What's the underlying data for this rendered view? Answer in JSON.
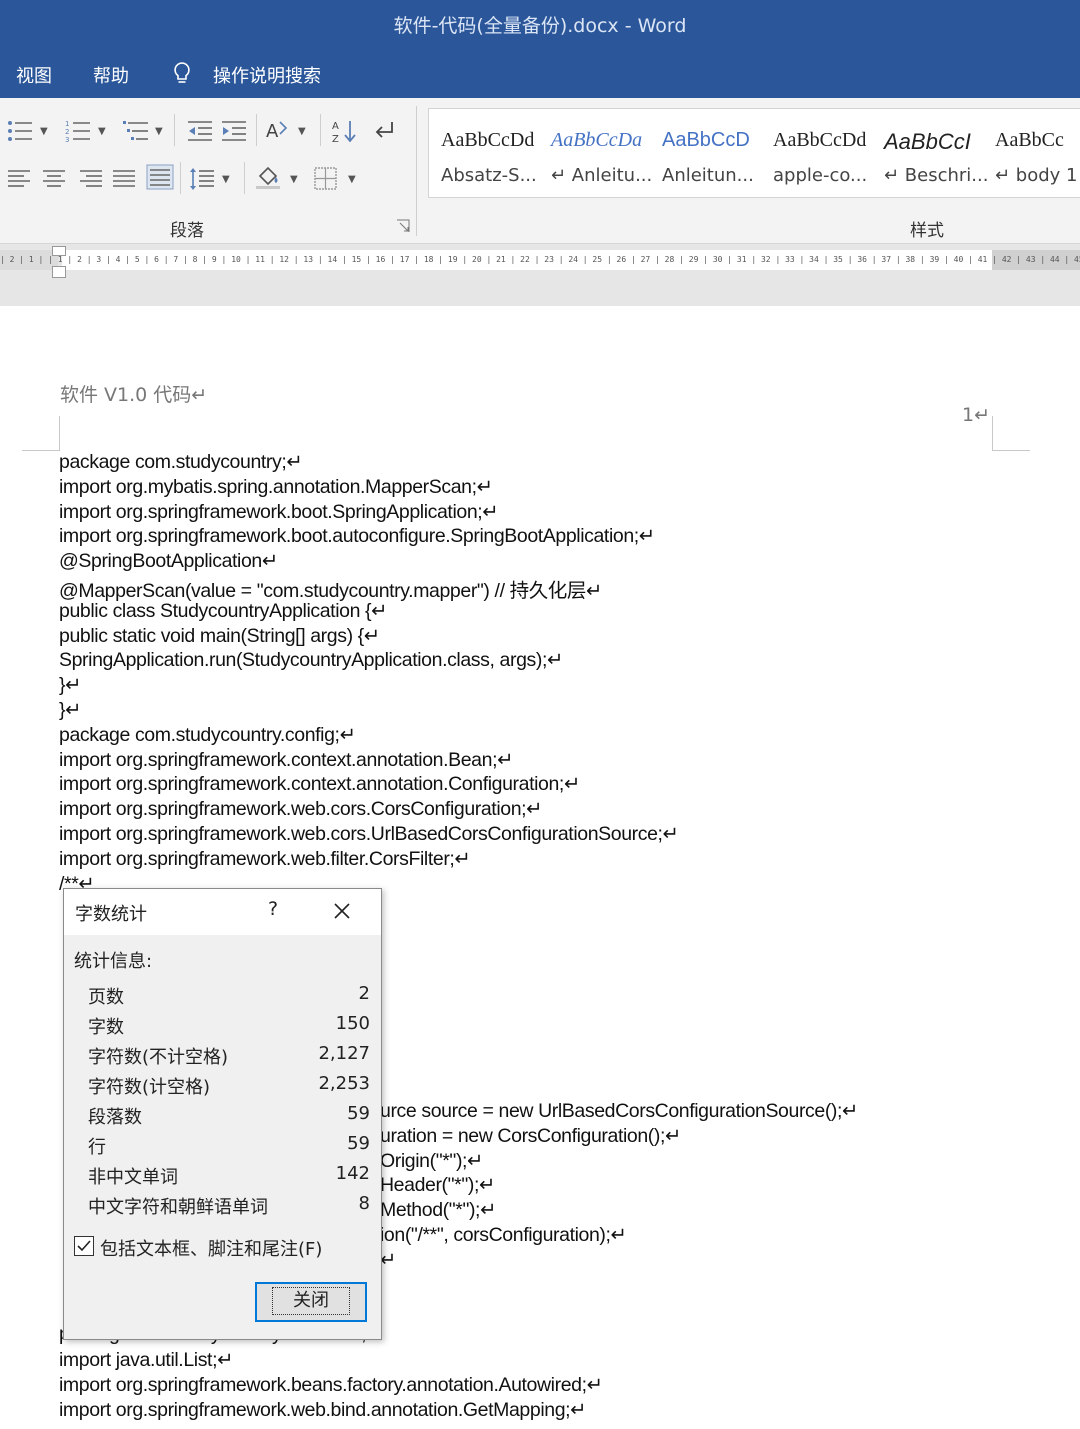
{
  "window": {
    "title": "软件-代码(全量备份).docx  -  Word"
  },
  "menu": {
    "items": [
      "视图",
      "帮助"
    ],
    "tell_me": "操作说明搜索"
  },
  "ribbon": {
    "paragraph_label": "段落",
    "styles_label": "样式",
    "styles": [
      {
        "sample": "AaBbCcDd",
        "name": "Absatz-S..."
      },
      {
        "sample": "AaBbCcDa",
        "name": "↵ Anleitu..."
      },
      {
        "sample": "AaBbCcD",
        "name": "Anleitun..."
      },
      {
        "sample": "AaBbCcDd",
        "name": "apple-co..."
      },
      {
        "sample": "AaBbCcI",
        "name": "↵ Beschri..."
      },
      {
        "sample": "AaBbCc",
        "name": "↵ body 1"
      }
    ]
  },
  "ruler": {
    "text": "| 2 | 1 |  | 1 | 2 | 3 | 4 | 5 | 6 | 7 | 8 | 9 | 10 | 11 | 12 | 13 | 14 | 15 | 16 | 17 | 18 | 19 | 20 | 21 | 22 | 23 | 24 | 25 | 26 | 27 | 28 | 29 | 30 | 31 | 32 | 33 | 34 | 35 | 36 | 37 | 38 | 39 | 40 | 41 | 42 | 43 | 44 | 45 | 46 | 47 | 48 | 49 |"
  },
  "document": {
    "header_left": "软件 V1.0  代码↵",
    "page_number": "1↵",
    "lines": [
      "package com.studycountry;↵",
      "import org.mybatis.spring.annotation.MapperScan;↵",
      "import org.springframework.boot.SpringApplication;↵",
      "import org.springframework.boot.autoconfigure.SpringBootApplication;↵",
      "@SpringBootApplication↵",
      "@MapperScan(value = \"com.studycountry.mapper\") // 持久化层↵",
      "public class StudycountryApplication {↵",
      "        public static void main(String[] args) {↵",
      "                SpringApplication.run(StudycountryApplication.class, args);↵",
      "        }↵",
      "}↵",
      "package com.studycountry.config;↵",
      "import org.springframework.context.annotation.Bean;↵",
      "import org.springframework.context.annotation.Configuration;↵",
      "import org.springframework.web.cors.CorsConfiguration;↵",
      "import org.springframework.web.cors.UrlBasedCorsConfigurationSource;↵",
      "import org.springframework.web.filter.CorsFilter;↵",
      "/**↵"
    ],
    "partial_lines": [
      "urce source = new UrlBasedCorsConfigurationSource();↵",
      "uration = new CorsConfiguration();↵",
      "Origin(\"*\");↵",
      "Header(\"*\");↵",
      "Method(\"*\");↵",
      "ion(\"/**\", corsConfiguration);↵",
      "↵"
    ],
    "tail_lines": [
      "package com.studycountry.controller;",
      "import java.util.List;↵",
      "import org.springframework.beans.factory.annotation.Autowired;↵",
      "import org.springframework.web.bind.annotation.GetMapping;↵"
    ]
  },
  "word_count_dialog": {
    "title": "字数统计",
    "help": "?",
    "section_label": "统计信息:",
    "stats": [
      {
        "label": "页数",
        "value": "2"
      },
      {
        "label": "字数",
        "value": "150"
      },
      {
        "label": "字符数(不计空格)",
        "value": "2,127"
      },
      {
        "label": "字符数(计空格)",
        "value": "2,253"
      },
      {
        "label": "段落数",
        "value": "59"
      },
      {
        "label": "行",
        "value": "59"
      },
      {
        "label": "非中文单词",
        "value": "142"
      },
      {
        "label": "中文字符和朝鲜语单词",
        "value": "8"
      }
    ],
    "checkbox_label": "包括文本框、脚注和尾注(F)",
    "checkbox_checked": true,
    "close_button": "关闭"
  },
  "colors": {
    "titlebar": "#2b579a",
    "ribbon": "#f3f3f3",
    "accent": "#0078d7"
  }
}
